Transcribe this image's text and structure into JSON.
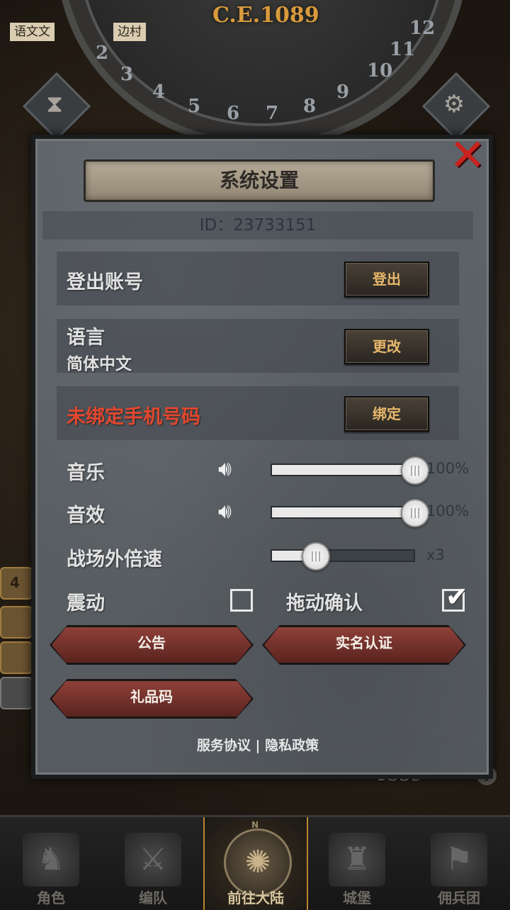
{
  "background": {
    "era_label": "C.E.1089",
    "dial_numbers": [
      "2",
      "3",
      "4",
      "5",
      "6",
      "7",
      "8",
      "9",
      "10",
      "11",
      "12"
    ],
    "map_tabs": [
      "语文文",
      "边村"
    ],
    "resource_value": "1339",
    "left_badge_count": "4"
  },
  "bottom_nav": {
    "items": [
      {
        "label": "角色",
        "icon": "knight-helmet-icon"
      },
      {
        "label": "编队",
        "icon": "armored-squad-icon"
      },
      {
        "label": "前往大陆",
        "icon": "compass-icon",
        "compass_letter": "N"
      },
      {
        "label": "城堡",
        "icon": "castle-icon"
      },
      {
        "label": "佣兵团",
        "icon": "mercenary-banner-icon"
      }
    ],
    "active_index": 2
  },
  "dialog": {
    "title": "系统设置",
    "id_text": "ID：23733151",
    "rows": {
      "logout": {
        "label": "登出账号",
        "button": "登出"
      },
      "language": {
        "label": "语言",
        "value": "简体中文",
        "button": "更改"
      },
      "phone": {
        "label": "未绑定手机号码",
        "button": "绑定"
      }
    },
    "music": {
      "label": "音乐",
      "value": 100,
      "value_text": "100%"
    },
    "sfx": {
      "label": "音效",
      "value": 100,
      "value_text": "100%"
    },
    "speed": {
      "label": "战场外倍速",
      "fraction": 0.3,
      "value_text": "x3"
    },
    "vibration": {
      "label": "震动",
      "checked": false
    },
    "drag_confirm": {
      "label": "拖动确认",
      "checked": true
    },
    "buttons": {
      "announcement": "公告",
      "real_name": "实名认证",
      "gift_code": "礼品码"
    },
    "footer": {
      "service": "服务协议",
      "separator": "|",
      "privacy": "隐私政策"
    },
    "colors": {
      "accent_gold": "#e7b86b",
      "warning_red": "#e2482e",
      "close_red": "#c8231e"
    }
  }
}
